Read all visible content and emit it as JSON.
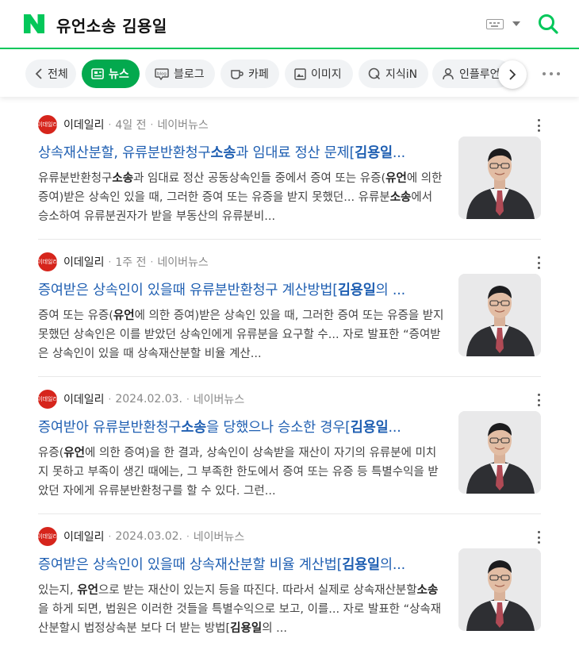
{
  "search": {
    "query": "유언소송 김용일"
  },
  "tabs": [
    {
      "label": "전체",
      "icon": "chevron-left-icon"
    },
    {
      "label": "뉴스",
      "icon": "news-icon",
      "active": true
    },
    {
      "label": "블로그",
      "icon": "blog-icon"
    },
    {
      "label": "카페",
      "icon": "cafe-icon"
    },
    {
      "label": "이미지",
      "icon": "image-icon"
    },
    {
      "label": "지식iN",
      "icon": "kin-icon"
    },
    {
      "label": "인플루언서",
      "icon": "person-icon"
    }
  ],
  "colors": {
    "brand_green": "#03c75a",
    "active_tab": "#03a94e",
    "title_link": "#1f5fb2",
    "source_logo": "#d6251c"
  },
  "results": [
    {
      "source": "이데일리",
      "logo_text": "이데일리",
      "date": "4일 전",
      "platform": "네이버뉴스",
      "title_html": "상속재산분할, 유류분반환청구<b>소송</b>과 임대료 정산 문제[<b>김용일</b>...",
      "snippet_html": "유류분반환청구<b>소송</b>과 임대료 정산 공동상속인들 중에서 증여 또는 유증(<b>유언</b>에 의한 증여)받은 상속인 있을 때, 그러한 증여 또는 유증을 받지 못했던... 유류분<b>소송</b>에서 승소하여 유류분권자가 받을 부동산의 유류분비..."
    },
    {
      "source": "이데일리",
      "logo_text": "이데일리",
      "date": "1주 전",
      "platform": "네이버뉴스",
      "title_html": "증여받은 상속인이 있을때 유류분반환청구 계산방법[<b>김용일</b>의 ...",
      "snippet_html": "증여 또는 유증(<b>유언</b>에 의한 증여)받은 상속인 있을 때, 그러한 증여 또는 유증을 받지 못했던 상속인은 이를 받았던 상속인에게 유류분을 요구할 수... 자로 발표한 “증여받은 상속인이 있을 때 상속재산분할 비율 계산..."
    },
    {
      "source": "이데일리",
      "logo_text": "이데일리",
      "date": "2024.02.03.",
      "platform": "네이버뉴스",
      "title_html": "증여받아 유류분반환청구<b>소송</b>을 당했으나 승소한 경우[<b>김용일</b>...",
      "snippet_html": "유증(<b>유언</b>에 의한 증여)을 한 결과, 상속인이 상속받을 재산이 자기의 유류분에 미치지 못하고 부족이 생긴 때에는, 그 부족한 한도에서 증여 또는 유증 등 특별수익을 받았던 자에게 유류분반환청구를 할 수 있다. 그런..."
    },
    {
      "source": "이데일리",
      "logo_text": "이데일리",
      "date": "2024.03.02.",
      "platform": "네이버뉴스",
      "title_html": "증여받은 상속인이 있을때 상속재산분할 비율 계산법[<b>김용일</b>의...",
      "snippet_html": "있는지, <b>유언</b>으로 받는 재산이 있는지 등을 따진다. 따라서 실제로 상속재산분할<b>소송</b>을 하게 되면, 법원은 이러한 것들을 특별수익으로 보고, 이를... 자로 발표한 “상속재산분할시 법정상속분 보다 더 받는 방법[<b>김용일</b>의 ..."
    }
  ]
}
